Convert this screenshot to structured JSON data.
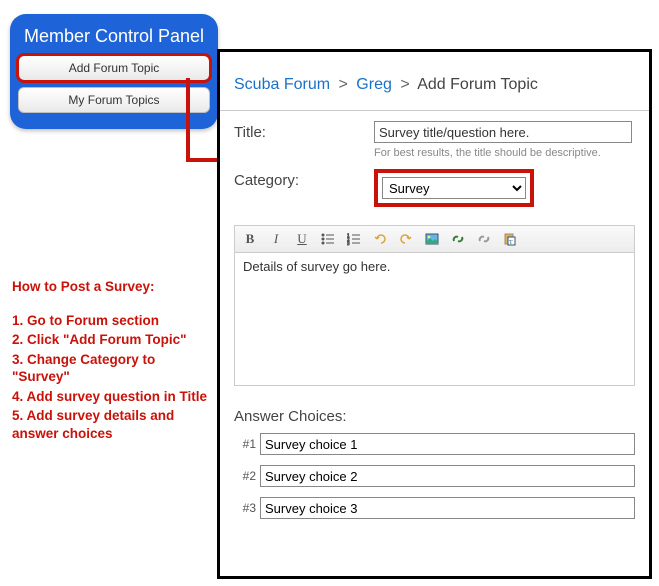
{
  "control_panel": {
    "title": "Member Control Panel",
    "btn_add": "Add Forum Topic",
    "btn_my": "My Forum Topics"
  },
  "instructions": {
    "heading": "How to Post a Survey:",
    "steps": [
      "1. Go to Forum section",
      "2. Click \"Add Forum Topic\"",
      "3. Change Category to \"Survey\"",
      "4. Add survey question in Title",
      "5. Add survey details and answer choices"
    ]
  },
  "breadcrumb": {
    "link1": "Scuba Forum",
    "link2": "Greg",
    "current": "Add Forum Topic",
    "sep": ">"
  },
  "form": {
    "title_label": "Title:",
    "title_value": "Survey title/question here.",
    "title_hint": "For best results, the title should be descriptive.",
    "category_label": "Category:",
    "category_value": "Survey",
    "details_value": "Details of survey go here.",
    "answers_label": "Answer Choices:",
    "answers": [
      {
        "num": "#1",
        "value": "Survey choice 1"
      },
      {
        "num": "#2",
        "value": "Survey choice 2"
      },
      {
        "num": "#3",
        "value": "Survey choice 3"
      }
    ]
  },
  "toolbar": {
    "bold": "B",
    "italic": "I",
    "underline": "U"
  }
}
